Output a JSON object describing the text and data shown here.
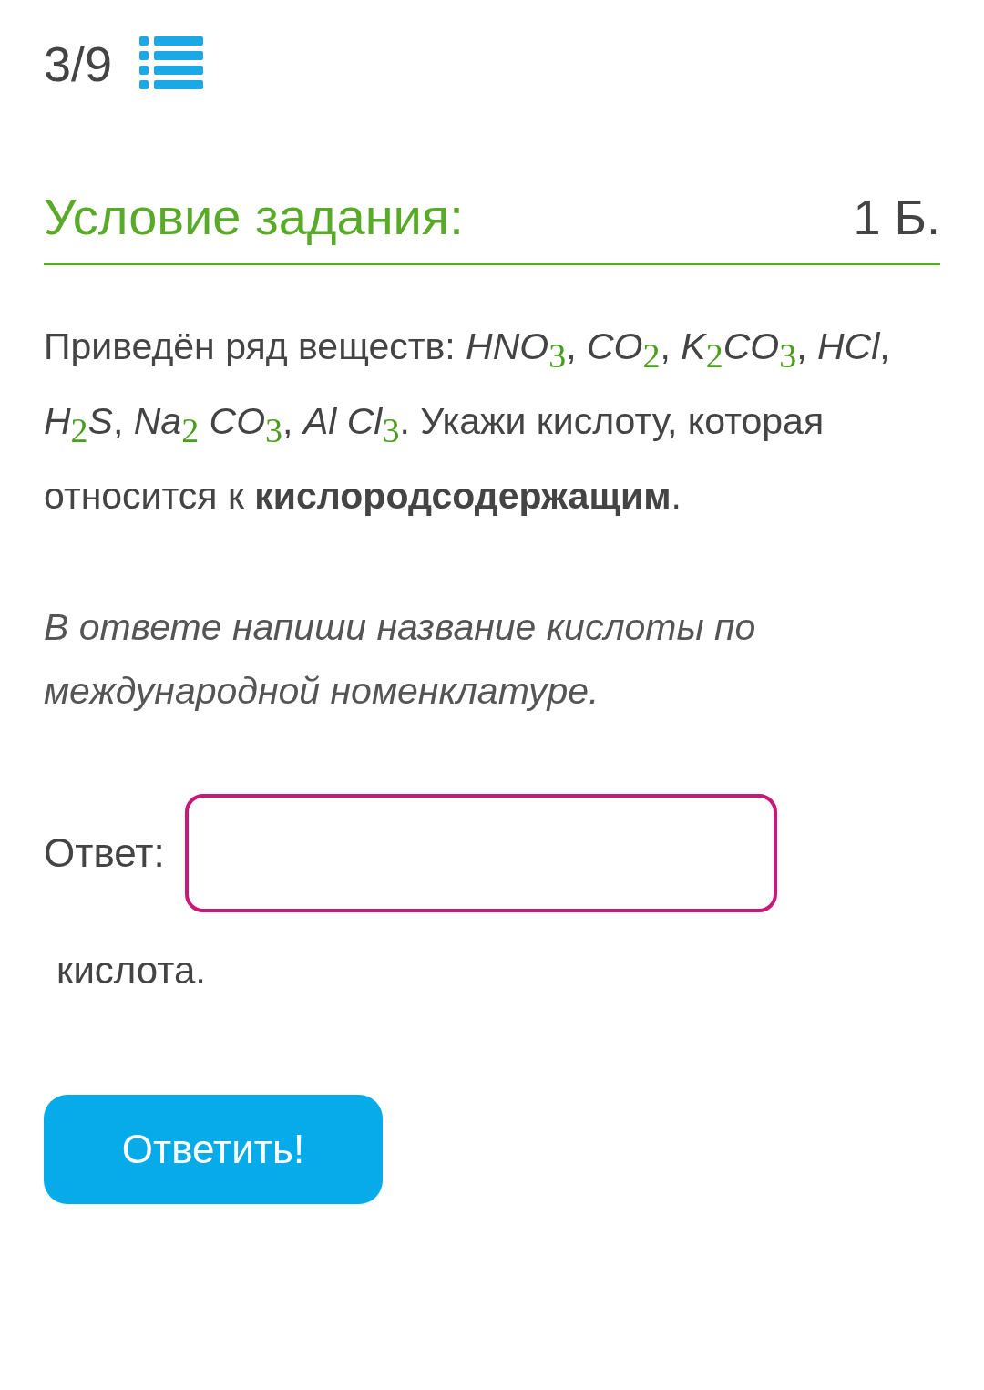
{
  "progress": {
    "counter": "3/9"
  },
  "task": {
    "heading": "Условие задания:",
    "points": "1 Б.",
    "text": "Приведён ряд веществ: *HNO*$_{3}$, *CO*$_{2}$, *K*$_{2}$*CO*$_{3}$, *HCl*, *H*$_{2}$*S*, *Na*$_{2}$ *CO*$_{3}$, *Al Cl*$_{3}$. Укажи кислоту, которая относится к **кислородсодержащим**.",
    "note": "В ответе напиши название кислоты по международной номенклатуре."
  },
  "answer": {
    "label": "Ответ:",
    "suffix": "кислота."
  },
  "submit_button": "Ответить!"
}
